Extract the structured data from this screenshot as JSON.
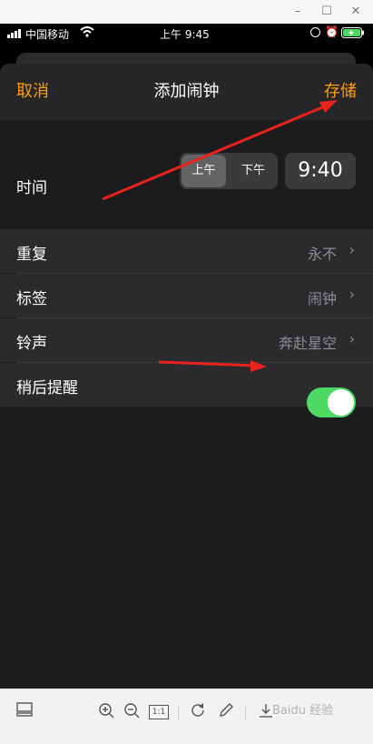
{
  "window": {
    "minimize": "–",
    "maximize": "☐",
    "close": "✕"
  },
  "status_bar": {
    "carrier": "中国移动",
    "time": "上午 9:45"
  },
  "nav": {
    "cancel": "取消",
    "title": "添加闹钟",
    "save": "存储"
  },
  "time_row": {
    "label": "时间",
    "am": "上午",
    "pm": "下午",
    "time": "9:40"
  },
  "settings": [
    {
      "label": "重复",
      "value": "永不"
    },
    {
      "label": "标签",
      "value": "闹钟"
    },
    {
      "label": "铃声",
      "value": "奔赴星空"
    },
    {
      "label": "稍后提醒",
      "value": ""
    }
  ],
  "snooze_on": true,
  "colors": {
    "accent": "#ff9f0a",
    "toggle_on": "#4cd964",
    "annotation_arrow": "#e8231d"
  },
  "toolbar": {
    "icons": [
      "panel-icon",
      "zoom-in-icon",
      "zoom-out-icon",
      "actual-size-icon",
      "rotate-icon",
      "edit-icon",
      "download-icon"
    ],
    "actual_size_label": "1:1"
  },
  "watermark": "Baidu 经验"
}
